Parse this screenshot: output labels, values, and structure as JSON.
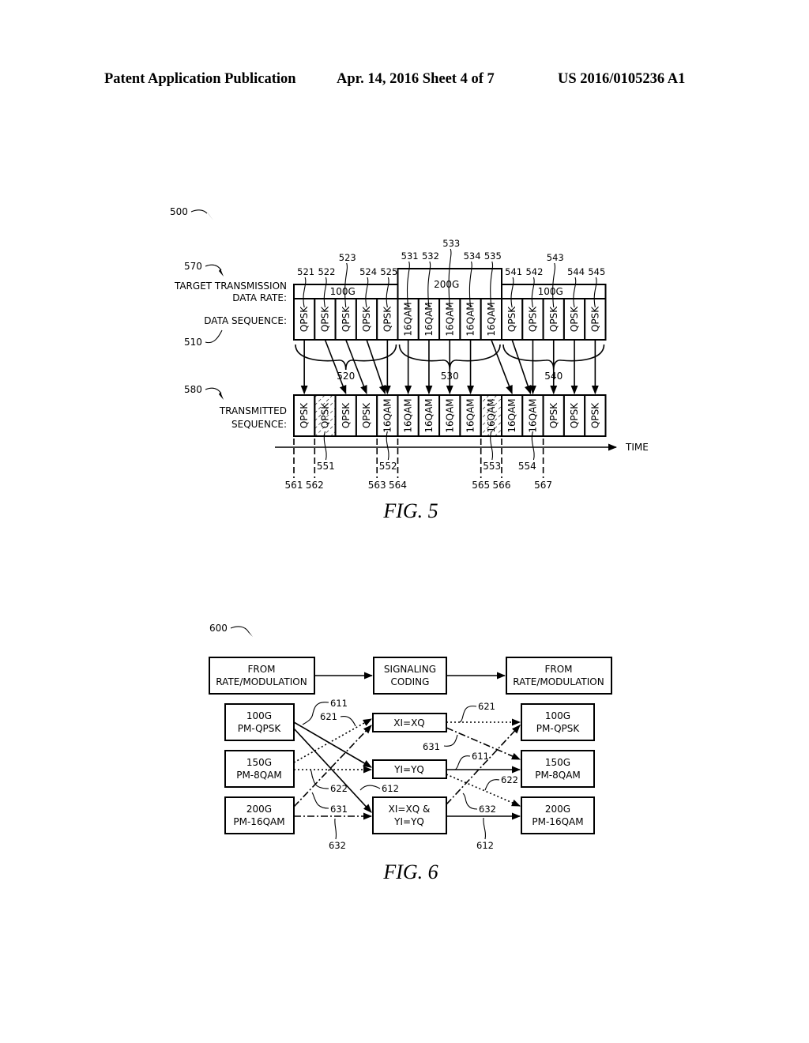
{
  "header": {
    "left": "Patent Application Publication",
    "middle": "Apr. 14, 2016  Sheet 4 of 7",
    "right": "US 2016/0105236 A1"
  },
  "fig5": {
    "caption": "FIG. 5",
    "ref_main": "500",
    "ref_rate": "570",
    "ref_data": "510",
    "ref_tx": "580",
    "label_rate_line1": "TARGET TRANSMISSION",
    "label_rate_line2": "DATA RATE:",
    "label_data": "DATA SEQUENCE:",
    "label_tx_line1": "TRANSMITTED",
    "label_tx_line2": "SEQUENCE:",
    "time_label": "TIME",
    "rate_groups": [
      {
        "label": "100G",
        "ref": "520"
      },
      {
        "label": "200G",
        "ref": "530"
      },
      {
        "label": "100G",
        "ref": "540"
      }
    ],
    "data_sequence": [
      {
        "symbol": "QPSK",
        "ref": "521"
      },
      {
        "symbol": "QPSK",
        "ref": "522"
      },
      {
        "symbol": "QPSK",
        "ref": "523"
      },
      {
        "symbol": "QPSK",
        "ref": "524"
      },
      {
        "symbol": "QPSK",
        "ref": "525"
      },
      {
        "symbol": "16QAM",
        "ref": "531"
      },
      {
        "symbol": "16QAM",
        "ref": "532"
      },
      {
        "symbol": "16QAM",
        "ref": "533"
      },
      {
        "symbol": "16QAM",
        "ref": "534"
      },
      {
        "symbol": "16QAM",
        "ref": "535"
      },
      {
        "symbol": "QPSK",
        "ref": "541"
      },
      {
        "symbol": "QPSK",
        "ref": "542"
      },
      {
        "symbol": "QPSK",
        "ref": "543"
      },
      {
        "symbol": "QPSK",
        "ref": "544"
      },
      {
        "symbol": "QPSK",
        "ref": "545"
      }
    ],
    "transmitted_sequence": [
      {
        "symbol": "QPSK",
        "hatched": false
      },
      {
        "symbol": "QPSK",
        "hatched": true
      },
      {
        "symbol": "QPSK",
        "hatched": false
      },
      {
        "symbol": "QPSK",
        "hatched": false
      },
      {
        "symbol": "16QAM",
        "hatched": false
      },
      {
        "symbol": "16QAM",
        "hatched": false
      },
      {
        "symbol": "16QAM",
        "hatched": false
      },
      {
        "symbol": "16QAM",
        "hatched": false
      },
      {
        "symbol": "16QAM",
        "hatched": false
      },
      {
        "symbol": "16QAM",
        "hatched": true
      },
      {
        "symbol": "16QAM",
        "hatched": false
      },
      {
        "symbol": "16QAM",
        "hatched": false
      },
      {
        "symbol": "QPSK",
        "hatched": false
      },
      {
        "symbol": "QPSK",
        "hatched": false
      },
      {
        "symbol": "QPSK",
        "hatched": false
      }
    ],
    "mapping": [
      0,
      2,
      3,
      4,
      4,
      5,
      6,
      7,
      8,
      10,
      11,
      11,
      12,
      13,
      14
    ],
    "transmitted_refs": [
      "551",
      "552",
      "553",
      "554"
    ],
    "time_refs": [
      "561",
      "562",
      "563",
      "564",
      "565",
      "566",
      "567"
    ]
  },
  "fig6": {
    "caption": "FIG. 6",
    "ref_main": "600",
    "top_left": [
      "FROM",
      "RATE/MODULATION"
    ],
    "top_middle": [
      "SIGNALING",
      "CODING"
    ],
    "top_right": [
      "FROM",
      "RATE/MODULATION"
    ],
    "left_boxes": [
      [
        "100G",
        "PM-QPSK"
      ],
      [
        "150G",
        "PM-8QAM"
      ],
      [
        "200G",
        "PM-16QAM"
      ]
    ],
    "middle_boxes": [
      [
        "XI=XQ"
      ],
      [
        "YI=YQ"
      ],
      [
        "XI=XQ &",
        "YI=YQ"
      ]
    ],
    "right_boxes": [
      [
        "100G",
        "PM-QPSK"
      ],
      [
        "150G",
        "PM-8QAM"
      ],
      [
        "200G",
        "PM-16QAM"
      ]
    ],
    "refs": {
      "r611a": "611",
      "r621a": "621",
      "r622a": "622",
      "r612a": "612",
      "r631a": "631",
      "r632a": "632",
      "r621b": "621",
      "r631b": "631",
      "r611b": "611",
      "r622b": "622",
      "r632b": "632",
      "r612b": "612"
    }
  }
}
